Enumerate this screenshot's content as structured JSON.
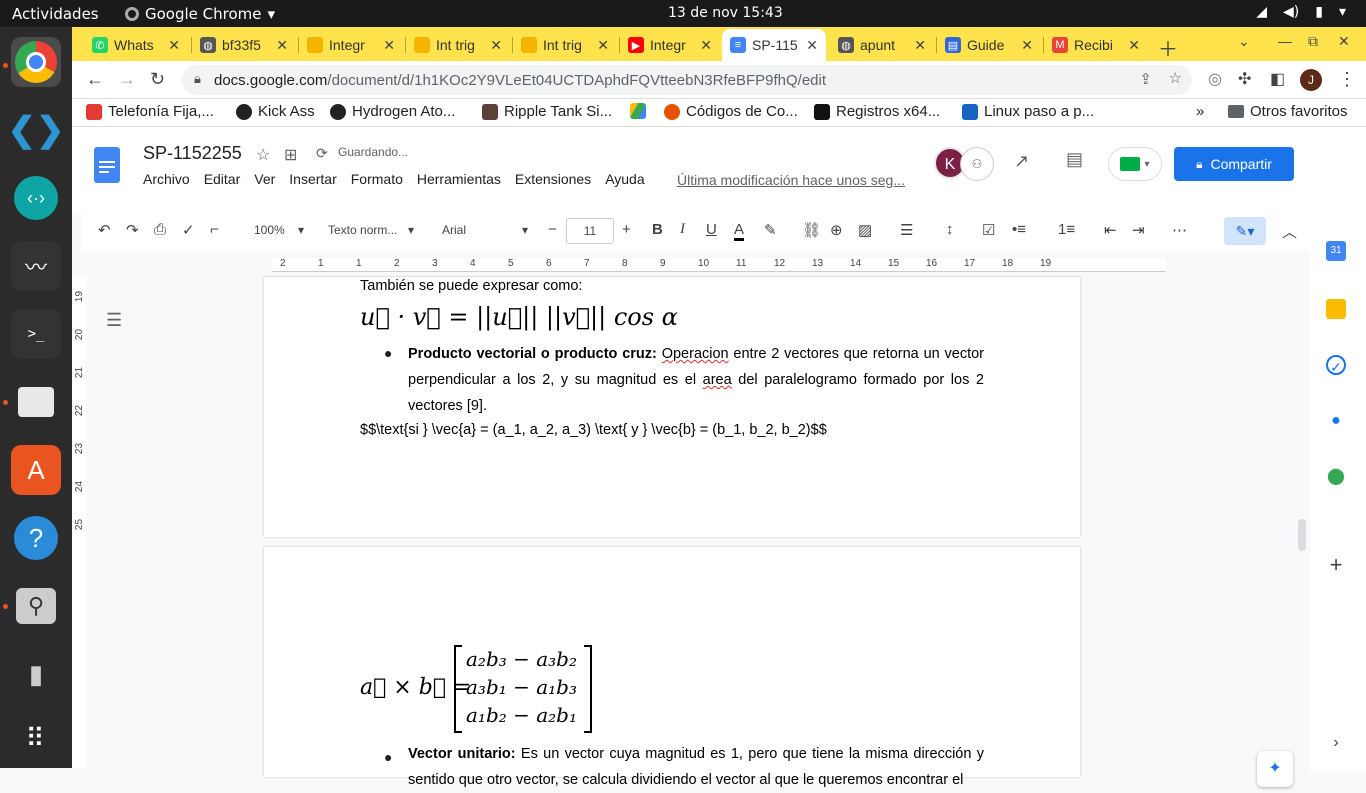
{
  "system": {
    "activities": "Actividades",
    "app_name": "Google Chrome",
    "clock": "13 de nov  15:43"
  },
  "tabs": [
    {
      "label": "Whats",
      "icon": "whatsapp-icon",
      "color": "#25d366"
    },
    {
      "label": "bf33f5",
      "icon": "globe-icon",
      "color": "#555555"
    },
    {
      "label": "Integr",
      "icon": "bookmark-icon",
      "color": "#f4b400"
    },
    {
      "label": "Int trig",
      "icon": "bookmark-icon",
      "color": "#f4b400"
    },
    {
      "label": "Int trig",
      "icon": "bookmark-icon",
      "color": "#f4b400"
    },
    {
      "label": "Integr",
      "icon": "youtube-icon",
      "color": "#ff0000"
    },
    {
      "label": "SP-115",
      "icon": "docs-icon",
      "color": "#4285f4",
      "active": true
    },
    {
      "label": "apunt",
      "icon": "globe-icon",
      "color": "#555555"
    },
    {
      "label": "Guide",
      "icon": "book-icon",
      "color": "#3367d6"
    },
    {
      "label": "Recibi",
      "icon": "gmail-icon",
      "color": "#ea4335"
    }
  ],
  "address": {
    "host": "docs.google.com",
    "path": "/document/d/1h1KOc2Y9VLeEt04UCTDAphdFQVtteebN3RfeBFP9fhQ/edit"
  },
  "bookmarks": [
    {
      "label": "Telefonía Fija,...",
      "color": "#e53935"
    },
    {
      "label": "Kick Ass",
      "color": "#222222"
    },
    {
      "label": "Hydrogen Ato...",
      "color": "#222222"
    },
    {
      "label": "Ripple Tank Si...",
      "color": "#5d4037"
    },
    {
      "label": "",
      "color": "#34a853"
    },
    {
      "label": "Códigos de Co...",
      "color": "#e65100"
    },
    {
      "label": "Registros x64...",
      "color": "#111111"
    },
    {
      "label": "Linux paso a p...",
      "color": "#1565c0"
    }
  ],
  "bookmarks_other": "Otros favoritos",
  "doc": {
    "title": "SP-1152255",
    "saving": "Guardando...",
    "menu": [
      "Archivo",
      "Editar",
      "Ver",
      "Insertar",
      "Formato",
      "Herramientas",
      "Extensiones",
      "Ayuda"
    ],
    "last_modified": "Última modificación hace unos seg...",
    "share": "Compartir",
    "avatar_k": "K",
    "avatar_j": "J"
  },
  "toolbar": {
    "zoom": "100%",
    "style": "Texto norm...",
    "font": "Arial",
    "size": "11",
    "bold": "B",
    "italic": "I",
    "underline": "U",
    "text_color": "A",
    "more": "⋯"
  },
  "ruler": {
    "h": [
      "2",
      "1",
      "1",
      "2",
      "3",
      "4",
      "5",
      "6",
      "7",
      "8",
      "9",
      "10",
      "11",
      "12",
      "13",
      "14",
      "15",
      "16",
      "17",
      "18",
      "19"
    ],
    "v": [
      "19",
      "20",
      "21",
      "22",
      "23",
      "24",
      "25"
    ]
  },
  "content": {
    "p1": "También se puede expresar como:",
    "eq1": "u⃗ · v⃗ = ||u⃗|| ||v⃗||  cos α",
    "b1_title": "Producto vectorial o producto cruz:",
    "b1_word": "Operacion",
    "b1_text_a": " entre 2 vectores que retorna un vector perpendicular a los 2, y su magnitud es el ",
    "b1_word2": "area",
    "b1_text_b": " del paralelogramo formado por los 2 vectores [9].",
    "latex": "$$\\text{si } \\vec{a} = (a_1, a_2, a_3) \\text{ y } \\vec{b} = (b_1, b_2, b_2)$$",
    "eq2_lhs": "a⃗ × b⃗ =",
    "eq2_rows": [
      "a₂b₃ − a₃b₂",
      "a₃b₁ − a₁b₃",
      "a₁b₂ − a₂b₁"
    ],
    "b2_title": "Vector unitario:",
    "b2_text": " Es un vector cuya magnitud es 1, pero que tiene la misma dirección y sentido que otro vector, se calcula dividiendo el vector al que le queremos encontrar el"
  }
}
